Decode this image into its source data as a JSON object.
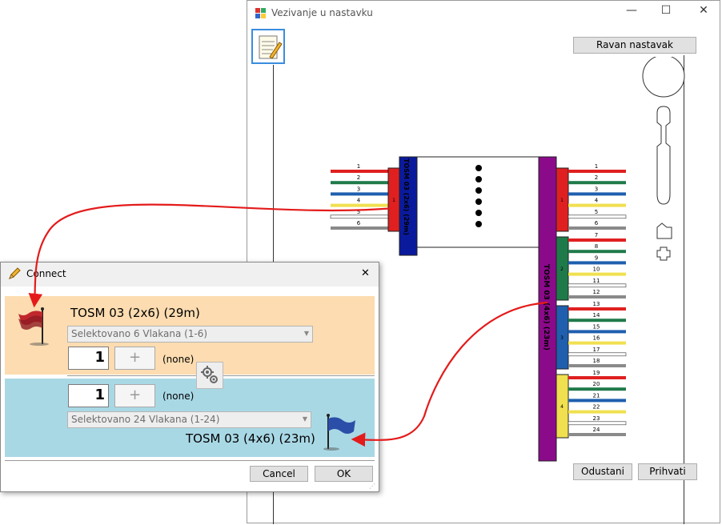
{
  "main_window": {
    "title": "Vezivanje u nastavku",
    "controls": {
      "minimize": "—",
      "maximize": "☐",
      "close": "✕"
    },
    "ravan_button": "Ravan nastavak",
    "odustani_button": "Odustani",
    "prihvati_button": "Prihvati"
  },
  "left_cable": {
    "label": "TOSM 03 (2x6) (29m)",
    "tube": "1",
    "fibers": [
      {
        "n": "1",
        "color": "#e02020"
      },
      {
        "n": "2",
        "color": "#1f7a4a"
      },
      {
        "n": "3",
        "color": "#1f5fae"
      },
      {
        "n": "4",
        "color": "#f0e050"
      },
      {
        "n": "5",
        "color": "#ffffff"
      },
      {
        "n": "6",
        "color": "#8a8a8a"
      }
    ]
  },
  "right_cable": {
    "label": "TOSM 03 (4x6) (23m)",
    "tubes": [
      {
        "n": "1",
        "color": "#e02020"
      },
      {
        "n": "2",
        "color": "#1f7a4a"
      },
      {
        "n": "3",
        "color": "#1f5fae"
      },
      {
        "n": "4",
        "color": "#f0e050"
      }
    ],
    "fiber_numbers": [
      "1",
      "2",
      "3",
      "4",
      "5",
      "6",
      "7",
      "8",
      "9",
      "10",
      "11",
      "12",
      "13",
      "14",
      "15",
      "16",
      "17",
      "18",
      "19",
      "20",
      "21",
      "22",
      "23",
      "24"
    ],
    "fiber_colors": [
      "#e02020",
      "#1f7a4a",
      "#1f5fae",
      "#f0e050",
      "#ffffff",
      "#8a8a8a"
    ]
  },
  "dialog": {
    "title": "Connect",
    "close": "✕",
    "top": {
      "cable": "TOSM 03 (2x6) (29m)",
      "combo": "Selektovano 6 Vlakana (1-6)",
      "number": "1",
      "plus": "+",
      "none": "(none)"
    },
    "bottom": {
      "cable": "TOSM 03 (4x6) (23m)",
      "combo": "Selektovano 24 Vlakana (1-24)",
      "number": "1",
      "plus": "+",
      "none": "(none)"
    },
    "cancel": "Cancel",
    "ok": "OK",
    "colors": {
      "top_bg": "#fcdcb0",
      "bottom_bg": "#a9d8e5"
    }
  }
}
